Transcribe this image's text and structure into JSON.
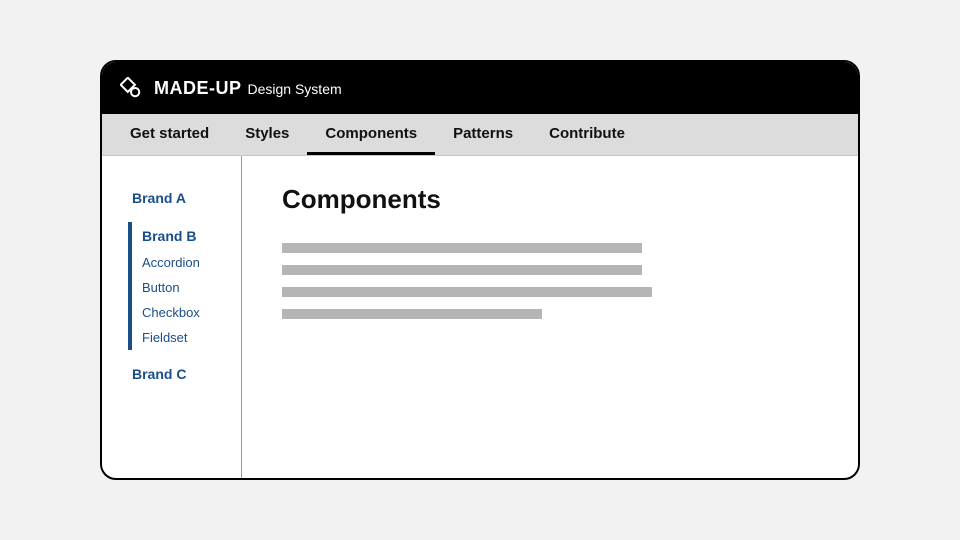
{
  "header": {
    "brand_strong": "MADE-UP",
    "brand_sub": "Design System"
  },
  "tabs": [
    {
      "label": "Get started",
      "active": false
    },
    {
      "label": "Styles",
      "active": false
    },
    {
      "label": "Components",
      "active": true
    },
    {
      "label": "Patterns",
      "active": false
    },
    {
      "label": "Contribute",
      "active": false
    }
  ],
  "sidebar": {
    "sections": [
      {
        "label": "Brand A",
        "expanded": false,
        "items": []
      },
      {
        "label": "Brand B",
        "expanded": true,
        "items": [
          {
            "label": "Accordion"
          },
          {
            "label": "Button"
          },
          {
            "label": "Checkbox"
          },
          {
            "label": "Fieldset"
          }
        ]
      },
      {
        "label": "Brand C",
        "expanded": false,
        "items": []
      }
    ]
  },
  "main": {
    "heading": "Components"
  },
  "colors": {
    "link": "#194e8a",
    "tabbar_bg": "#dcdcdc",
    "placeholder": "#b5b5b5"
  }
}
